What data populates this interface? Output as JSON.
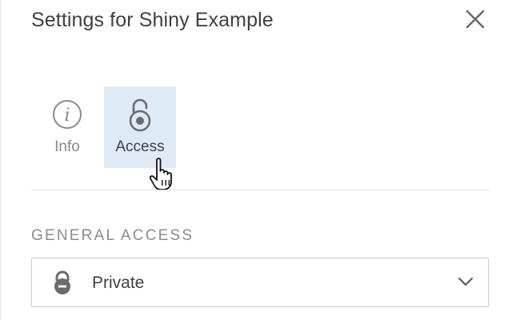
{
  "dialog": {
    "title": "Settings for Shiny Example"
  },
  "tabs": [
    {
      "label": "Info",
      "icon": "info-icon",
      "selected": false
    },
    {
      "label": "Access",
      "icon": "open-lock-icon",
      "selected": true
    }
  ],
  "general_access": {
    "label": "GENERAL ACCESS",
    "selected_value": "Private",
    "icon": "lock-icon"
  },
  "colors": {
    "selected_tab_bg": "#deebf7",
    "text": "#404040",
    "muted_text": "#8a8a8a"
  }
}
